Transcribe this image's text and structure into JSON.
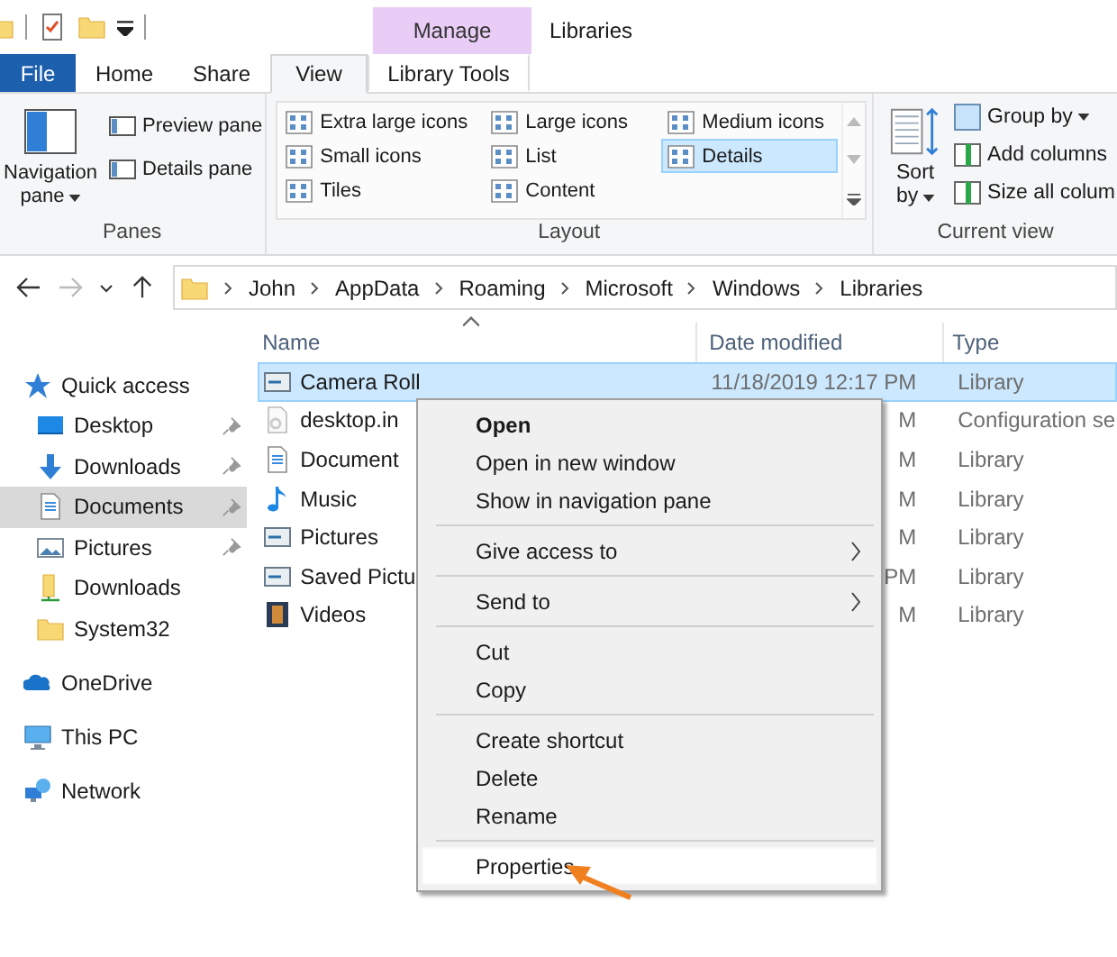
{
  "window": {
    "title": "Libraries"
  },
  "contextual_tab_group": {
    "label": "Manage"
  },
  "tabs": [
    {
      "label": "File",
      "kind": "file",
      "selected": false
    },
    {
      "label": "Home",
      "kind": "normal",
      "selected": false
    },
    {
      "label": "Share",
      "kind": "normal",
      "selected": false
    },
    {
      "label": "View",
      "kind": "normal",
      "selected": true
    },
    {
      "label": "Library Tools",
      "kind": "contextual",
      "selected": false
    }
  ],
  "ribbon": {
    "panes": {
      "label": "Panes",
      "large": {
        "label": "Navigation",
        "label_2": "pane",
        "dropdown": true
      },
      "small": [
        {
          "label": "Preview pane"
        },
        {
          "label": "Details pane"
        }
      ]
    },
    "layout": {
      "label": "Layout",
      "items": [
        {
          "label": "Extra large icons",
          "selected": false
        },
        {
          "label": "Large icons",
          "selected": false
        },
        {
          "label": "Medium icons",
          "selected": false
        },
        {
          "label": "Small icons",
          "selected": false
        },
        {
          "label": "List",
          "selected": false
        },
        {
          "label": "Details",
          "selected": true
        },
        {
          "label": "Tiles",
          "selected": false
        },
        {
          "label": "Content",
          "selected": false
        }
      ]
    },
    "current_view": {
      "label": "Current view",
      "large": {
        "label": "Sort",
        "label_2": "by",
        "dropdown": true
      },
      "small": [
        {
          "label": "Group by",
          "dropdown": true
        },
        {
          "label": "Add columns",
          "dropdown": false
        },
        {
          "label": "Size all colum",
          "dropdown": false
        }
      ]
    }
  },
  "address_bar": {
    "segments": [
      "John",
      "AppData",
      "Roaming",
      "Microsoft",
      "Windows",
      "Libraries"
    ]
  },
  "navigation": [
    {
      "label": "Quick access",
      "selected": false,
      "children": [
        {
          "label": "Desktop",
          "pinned": true,
          "selected": false
        },
        {
          "label": "Downloads",
          "pinned": true,
          "selected": false
        },
        {
          "label": "Documents",
          "pinned": true,
          "selected": true
        },
        {
          "label": "Pictures",
          "pinned": true,
          "selected": false
        },
        {
          "label": "Downloads",
          "pinned": false,
          "selected": false
        },
        {
          "label": "System32",
          "pinned": false,
          "selected": false
        }
      ]
    },
    {
      "label": "OneDrive",
      "selected": false
    },
    {
      "label": "This PC",
      "selected": false
    },
    {
      "label": "Network",
      "selected": false
    }
  ],
  "file_list": {
    "columns": [
      "Name",
      "Date modified",
      "Type"
    ],
    "rows": [
      {
        "name": "Camera Roll",
        "date": "11/18/2019 12:17 PM",
        "type": "Library",
        "selected": true
      },
      {
        "name": "desktop.in",
        "date": "M",
        "type": "Configuration se",
        "selected": false
      },
      {
        "name": "Document",
        "date": "M",
        "type": "Library",
        "selected": false
      },
      {
        "name": "Music",
        "date": "M",
        "type": "Library",
        "selected": false
      },
      {
        "name": "Pictures",
        "date": "M",
        "type": "Library",
        "selected": false
      },
      {
        "name": "Saved Pictu",
        "date": "PM",
        "type": "Library",
        "selected": false
      },
      {
        "name": "Videos",
        "date": "M",
        "type": "Library",
        "selected": false
      }
    ]
  },
  "context_menu": {
    "groups": [
      [
        {
          "label": "Open",
          "default": true,
          "submenu": false,
          "selected": false
        },
        {
          "label": "Open in new window",
          "default": false,
          "submenu": false,
          "selected": false
        },
        {
          "label": "Show in navigation pane",
          "default": false,
          "submenu": false,
          "selected": false
        }
      ],
      [
        {
          "label": "Give access to",
          "default": false,
          "submenu": true,
          "selected": false
        }
      ],
      [
        {
          "label": "Send to",
          "default": false,
          "submenu": true,
          "selected": false
        }
      ],
      [
        {
          "label": "Cut",
          "default": false,
          "submenu": false,
          "selected": false
        },
        {
          "label": "Copy",
          "default": false,
          "submenu": false,
          "selected": false
        }
      ],
      [
        {
          "label": "Create shortcut",
          "default": false,
          "submenu": false,
          "selected": false
        },
        {
          "label": "Delete",
          "default": false,
          "submenu": false,
          "selected": false
        },
        {
          "label": "Rename",
          "default": false,
          "submenu": false,
          "selected": false
        }
      ],
      [
        {
          "label": "Properties",
          "default": false,
          "submenu": false,
          "selected": true
        }
      ]
    ]
  }
}
